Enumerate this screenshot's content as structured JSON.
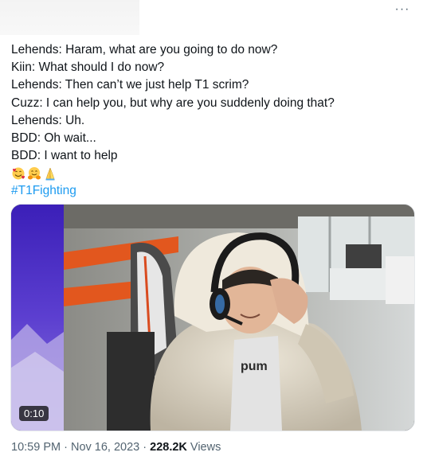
{
  "tweet": {
    "more_label": "···",
    "lines": [
      "Lehends: Haram, what are you going to do now?",
      "Kiin: What should I do now?",
      "Lehends: Then can’t we just help T1 scrim?",
      "Cuzz: I can help you, but why are you suddenly doing that?",
      "Lehends: Uh.",
      "BDD: Oh wait...",
      "BDD: I want to help"
    ],
    "emojis": [
      "smiling-face-with-hearts",
      "hugging-face",
      "folded-hands"
    ],
    "hashtag": "#T1Fighting"
  },
  "media": {
    "duration": "0:10"
  },
  "meta": {
    "time": "10:59 PM",
    "separator": " · ",
    "date": "Nov 16, 2023",
    "views_count": "228.2K",
    "views_label": " Views"
  }
}
